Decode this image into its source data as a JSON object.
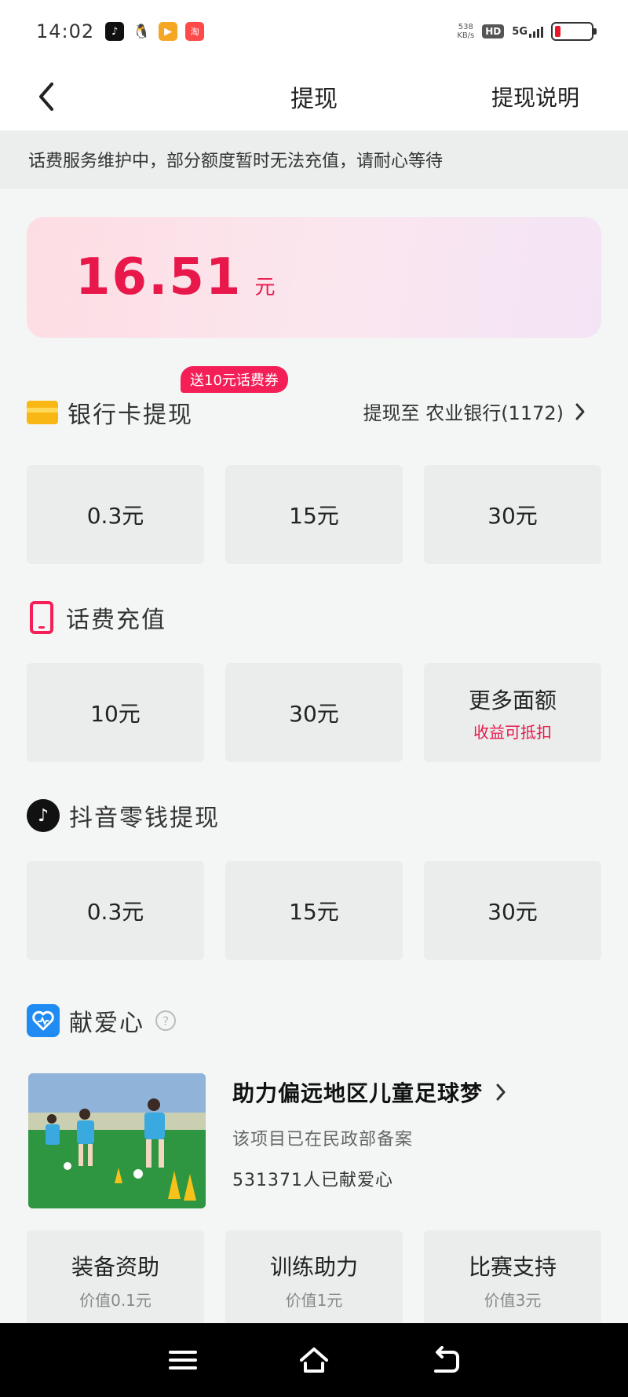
{
  "status_bar": {
    "time": "14:02",
    "net_speed_value": "538",
    "net_speed_unit": "KB/s",
    "hd_label": "HD",
    "network_label": "5G",
    "battery_level": 0.15,
    "battery_color": "#e8182a"
  },
  "nav": {
    "title": "提现",
    "help_label": "提现说明"
  },
  "notice": {
    "text": "话费服务维护中，部分额度暂时无法充值，请耐心等待"
  },
  "balance": {
    "amount": "16.51",
    "unit": "元"
  },
  "bank_section": {
    "promo_badge": "送10元话费券",
    "title": "银行卡提现",
    "target": "提现至 农业银行(1172)",
    "options": [
      "0.3元",
      "15元",
      "30元"
    ]
  },
  "phone_section": {
    "title": "话费充值",
    "options": [
      "10元",
      "30元"
    ],
    "more_label": "更多面额",
    "more_sub": "收益可抵扣"
  },
  "douyin_section": {
    "title": "抖音零钱提现",
    "options": [
      "0.3元",
      "15元",
      "30元"
    ]
  },
  "charity_section": {
    "title": "献爱心",
    "help_icon": "?",
    "project_title": "助力偏远地区儿童足球梦",
    "project_note": "该项目已在民政部备案",
    "donor_count": "531371人已献爱心",
    "options": [
      {
        "label": "装备资助",
        "value": "价值0.1元"
      },
      {
        "label": "训练助力",
        "value": "价值1元"
      },
      {
        "label": "比赛支持",
        "value": "价值3元"
      }
    ]
  },
  "colors": {
    "accent": "#e8184a",
    "promo": "#f41f57",
    "card_icon": "#f9b715",
    "love_icon": "#1f8bf3"
  }
}
